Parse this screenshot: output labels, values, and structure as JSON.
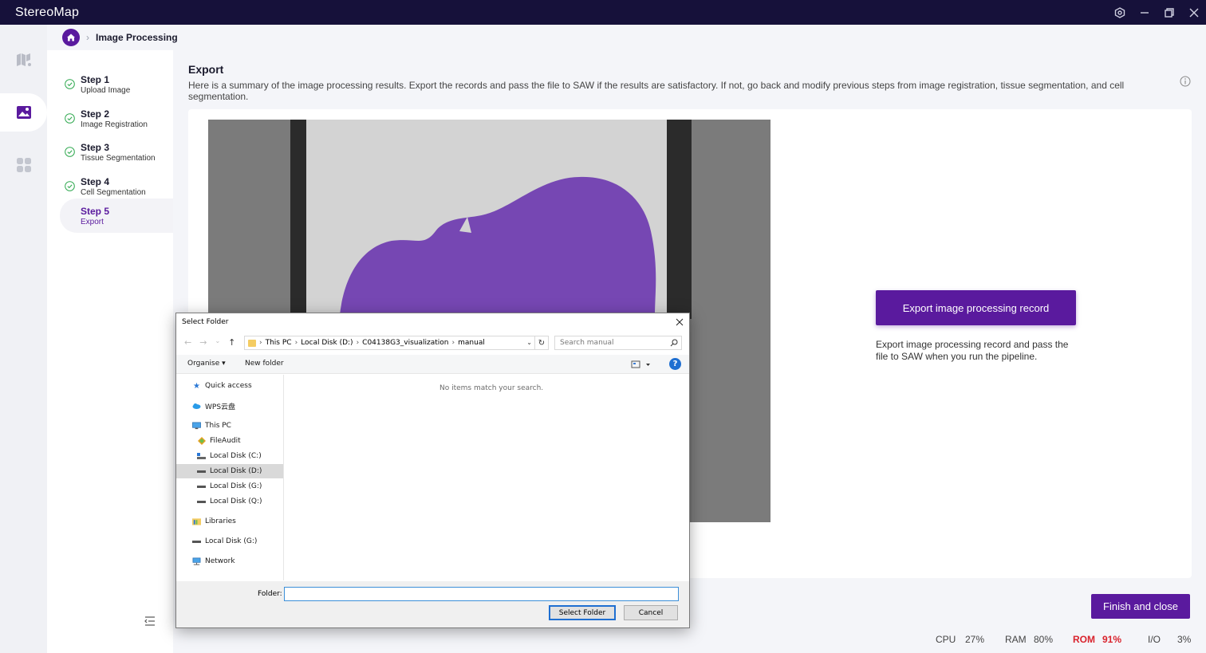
{
  "app": {
    "title": "StereoMap"
  },
  "breadcrumb": {
    "current": "Image Processing",
    "separator": "›"
  },
  "steps": [
    {
      "title": "Step 1",
      "subtitle": "Upload Image",
      "done": true
    },
    {
      "title": "Step 2",
      "subtitle": "Image Registration",
      "done": true
    },
    {
      "title": "Step 3",
      "subtitle": "Tissue Segmentation",
      "done": true
    },
    {
      "title": "Step 4",
      "subtitle": "Cell Segmentation",
      "done": true
    },
    {
      "title": "Step 5",
      "subtitle": "Export",
      "done": false,
      "active": true
    }
  ],
  "section": {
    "title": "Export",
    "description": "Here is a summary of the image processing results. Export the records and pass the file to SAW if the results are satisfactory. If not, go back and modify previous steps from image registration, tissue segmentation, and cell segmentation."
  },
  "export": {
    "button_label": "Export image processing record",
    "description": "Export image processing record and pass the file to SAW when you run the pipeline."
  },
  "finish_button": "Finish and close",
  "status_bar": {
    "cpu_label": "CPU",
    "cpu_value": "27%",
    "ram_label": "RAM",
    "ram_value": "80%",
    "rom_label": "ROM",
    "rom_value": "91%",
    "io_label": "I/O",
    "io_value": "3%"
  },
  "dialog": {
    "title": "Select Folder",
    "path": [
      "This PC",
      "Local Disk (D:)",
      "C04138G3_visualization",
      "manual"
    ],
    "search_placeholder": "Search manual",
    "organise": "Organise ▾",
    "new_folder": "New folder",
    "help": "?",
    "nav_items": [
      {
        "label": "Quick access",
        "icon": "star-icon"
      },
      {
        "label": "WPS云盘",
        "icon": "cloud-icon"
      },
      {
        "label": "This PC",
        "icon": "computer-icon"
      },
      {
        "label": "FileAudit",
        "icon": "fileaudit-icon"
      },
      {
        "label": "Local Disk (C:)",
        "icon": "drive-icon"
      },
      {
        "label": "Local Disk (D:)",
        "icon": "drive-icon",
        "selected": true
      },
      {
        "label": "Local Disk  (G:)",
        "icon": "drive-icon"
      },
      {
        "label": "Local Disk (Q:)",
        "icon": "drive-icon"
      },
      {
        "label": "Libraries",
        "icon": "library-icon"
      },
      {
        "label": "Local Disk  (G:)",
        "icon": "drive-icon"
      },
      {
        "label": "Network",
        "icon": "network-icon"
      }
    ],
    "empty_message": "No items match your search.",
    "folder_label": "Folder:",
    "folder_value": "",
    "select_button": "Select Folder",
    "cancel_button": "Cancel"
  },
  "colors": {
    "brand": "#5a1a9e",
    "titlebar": "#16113a",
    "tissue": "#7647b3",
    "rom_alert": "#d9232d"
  }
}
